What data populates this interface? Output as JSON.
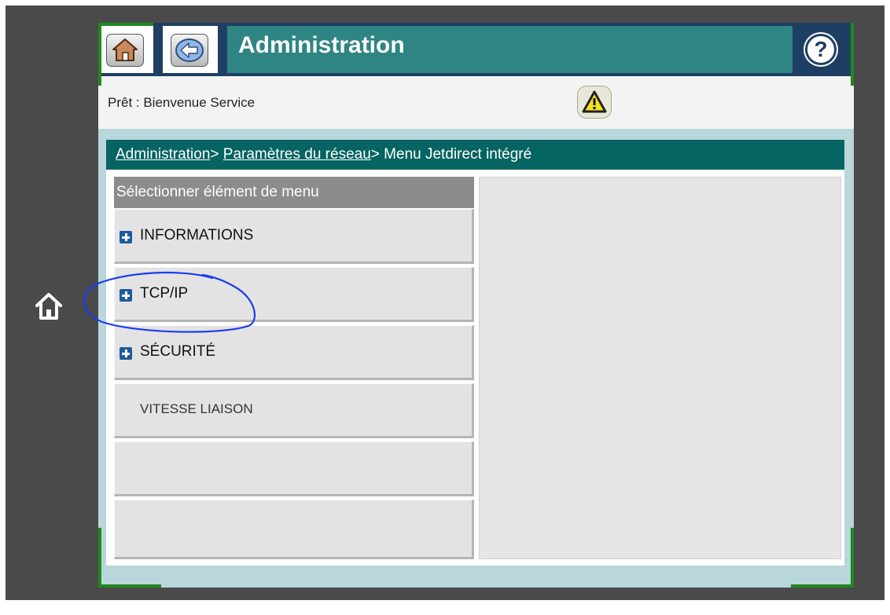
{
  "header": {
    "home_icon": "home-icon",
    "back_icon": "back-arrow-icon",
    "title": "Administration",
    "help_label": "?"
  },
  "status": {
    "text": "Prêt : Bienvenue Service",
    "warning_icon": "warning-icon"
  },
  "breadcrumb": {
    "items": [
      "Administration",
      "Paramètres du réseau",
      "Menu Jetdirect intégré"
    ],
    "separator": ">"
  },
  "menu": {
    "heading": "Sélectionner élément de menu",
    "items": [
      {
        "label": "INFORMATIONS",
        "expandable": true
      },
      {
        "label": "TCP/IP",
        "expandable": true
      },
      {
        "label": "SÉCURITÉ",
        "expandable": true
      },
      {
        "label": "VITESSE LIAISON",
        "expandable": false
      },
      {
        "label": "",
        "expandable": false
      },
      {
        "label": "",
        "expandable": false
      }
    ]
  },
  "side": {
    "home_icon": "home-outline-icon"
  },
  "colors": {
    "title_bar": "#2e8583",
    "breadcrumb_bar": "#066462",
    "header_dark": "#1e3f63",
    "annotation": "#1a3cf0",
    "frame_corner": "#1f8a1f"
  }
}
